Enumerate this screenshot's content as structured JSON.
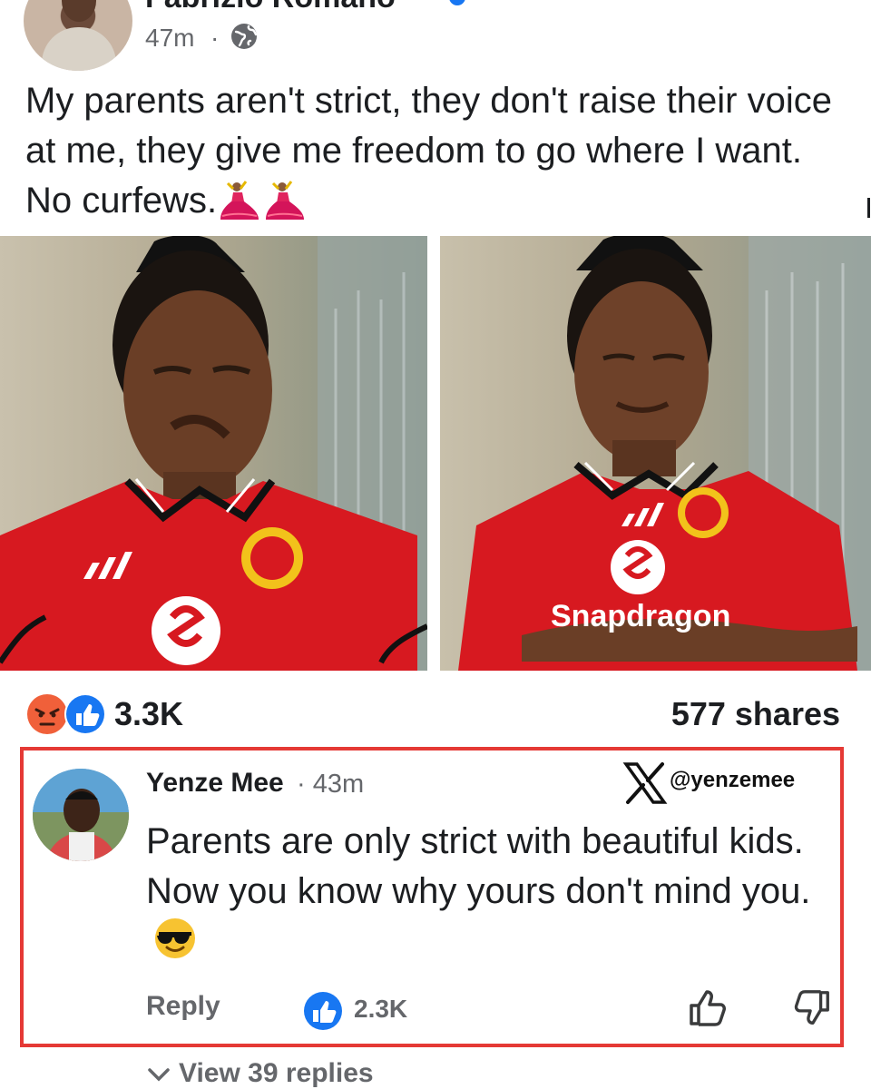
{
  "post": {
    "author_name": "Fabrizio Romano",
    "time": "47m",
    "separator": "·",
    "privacy_icon": "globe-icon",
    "text": "My parents aren't strict, they don't raise their voice at me, they give me freedom to go where I want. No curfews.",
    "text_emoji": "dancer-icon",
    "photos": [
      {
        "shirt_sponsor": "",
        "expression": "frown"
      },
      {
        "shirt_sponsor": "Snapdragon",
        "expression": "smile"
      }
    ],
    "reaction_icons": [
      "angry-icon",
      "like-icon"
    ],
    "reactions_count": "3.3K",
    "shares": "577 shares"
  },
  "comment": {
    "author": "Yenze Mee",
    "separator": "·",
    "time": "43m",
    "watermark_handle": "@yenzemee",
    "text": "Parents are only strict with beautiful kids. Now you know why yours don't mind you.",
    "text_emoji": "sunglasses-icon",
    "reply_label": "Reply",
    "likes": "2.3K",
    "view_replies": "View 39 replies"
  },
  "colors": {
    "highlight_border": "#e53935",
    "facebook_blue": "#1877f2",
    "jersey_red": "#d71920",
    "muted_text": "#65676b"
  }
}
